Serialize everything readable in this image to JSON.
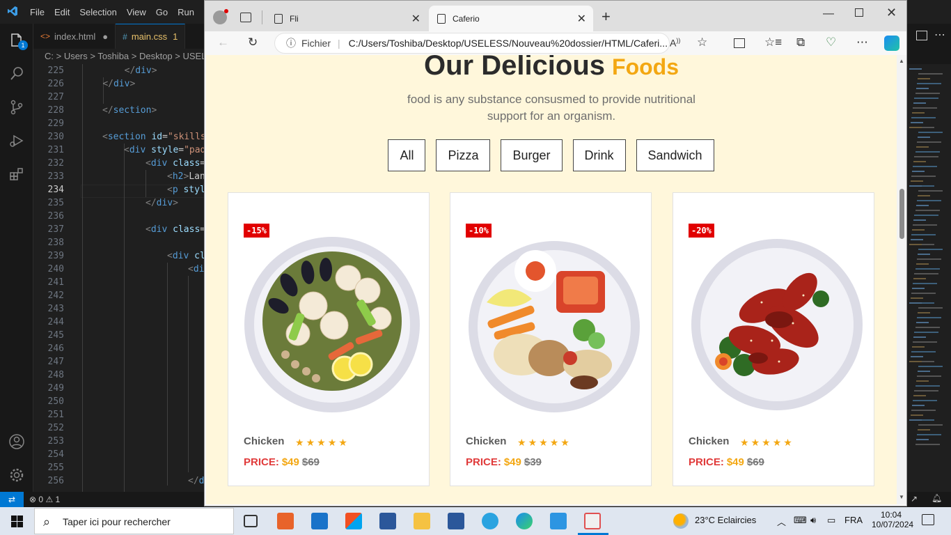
{
  "vscode": {
    "menu": [
      "File",
      "Edit",
      "Selection",
      "View",
      "Go",
      "Run"
    ],
    "tabs": [
      {
        "icon": "<>",
        "label": "index.html",
        "marker": "●"
      },
      {
        "icon": "#",
        "label": "main.css",
        "marker": "1"
      }
    ],
    "breadcrumb": "C: > Users > Toshiba > Desktop > USELE",
    "explorer_badge": "1",
    "line_numbers": [
      "225",
      "226",
      "227",
      "228",
      "229",
      "230",
      "231",
      "232",
      "233",
      "234",
      "235",
      "236",
      "237",
      "238",
      "239",
      "240",
      "241",
      "242",
      "243",
      "244",
      "245",
      "246",
      "247",
      "248",
      "249",
      "250",
      "251",
      "252",
      "253",
      "254",
      "255",
      "256"
    ],
    "status": {
      "errors": "0",
      "warnings": "1"
    }
  },
  "browser": {
    "tabs": [
      {
        "label": "Fli"
      },
      {
        "label": "Caferio"
      }
    ],
    "url_prefix": "Fichier",
    "url": "C:/Users/Toshiba/Desktop/USELESS/Nouveau%20dossier/HTML/Caferi..."
  },
  "page": {
    "heading": "Our Delicious",
    "heading_highlight": "Foods",
    "subtitle": "food is any substance consusmed to provide nutritional support for an organism.",
    "filters": [
      "All",
      "Pizza",
      "Burger",
      "Drink",
      "Sandwich"
    ],
    "products": [
      {
        "discount": "-15%",
        "name": "Chicken",
        "rating": 5,
        "price_label": "PRICE:",
        "price": "$49",
        "old_price": "$69"
      },
      {
        "discount": "-10%",
        "name": "Chicken",
        "rating": 5,
        "price_label": "PRICE:",
        "price": "$49",
        "old_price": "$39"
      },
      {
        "discount": "-20%",
        "name": "Chicken",
        "rating": 5,
        "price_label": "PRICE:",
        "price": "$49",
        "old_price": "$69"
      }
    ],
    "colors": {
      "accent": "#f3a712",
      "price": "#e03a3a",
      "discount": "#e10000",
      "background": "#fff7db"
    }
  },
  "taskbar": {
    "search_placeholder": "Taper ici pour rechercher",
    "weather": "23°C  Eclaircies",
    "language": "FRA",
    "time": "10:04",
    "date": "10/07/2024"
  }
}
